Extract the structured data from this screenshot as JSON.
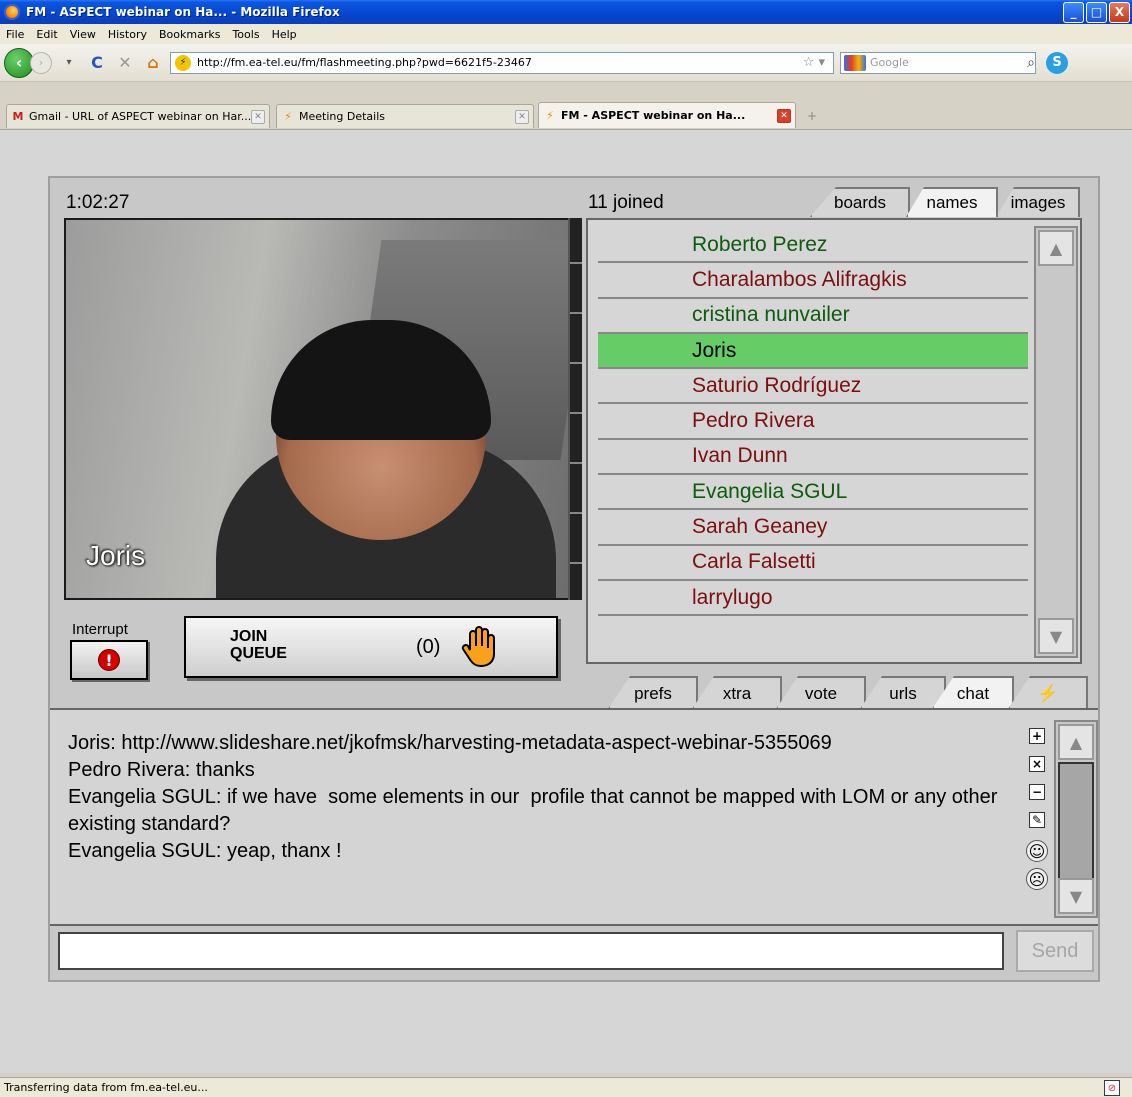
{
  "window": {
    "title": "FM - ASPECT webinar on Ha... - Mozilla Firefox",
    "minimize": "_",
    "maximize": "□",
    "close": "X"
  },
  "menu": [
    "File",
    "Edit",
    "View",
    "History",
    "Bookmarks",
    "Tools",
    "Help"
  ],
  "nav": {
    "url": "http://fm.ea-tel.eu/fm/flashmeeting.php?pwd=6621f5-23467",
    "search_placeholder": "Google"
  },
  "tabs": [
    {
      "label": "Gmail - URL of ASPECT webinar on Har...",
      "icon": "gmail-icon"
    },
    {
      "label": "Meeting Details",
      "icon": "flash-icon"
    },
    {
      "label": "FM - ASPECT webinar on Ha...",
      "icon": "flash-icon",
      "active": true
    }
  ],
  "meeting": {
    "timer": "1:02:27",
    "joined": "11 joined",
    "video_name": "Joris",
    "interrupt_label": "Interrupt",
    "queue_label": "JOIN\nQUEUE",
    "queue_count": "(0)"
  },
  "panel_tabs": [
    "boards",
    "names",
    "images"
  ],
  "active_panel_tab": "names",
  "names": [
    {
      "name": "Roberto Perez",
      "color": "green"
    },
    {
      "name": "Charalambos Alifragkis",
      "color": "red"
    },
    {
      "name": "cristina nunvailer",
      "color": "green"
    },
    {
      "name": "Joris",
      "color": "green",
      "selected": true
    },
    {
      "name": "Saturio Rodríguez",
      "color": "red"
    },
    {
      "name": "Pedro Rivera",
      "color": "red"
    },
    {
      "name": "Ivan Dunn",
      "color": "red"
    },
    {
      "name": "Evangelia SGUL",
      "color": "green"
    },
    {
      "name": "Sarah Geaney",
      "color": "red"
    },
    {
      "name": "Carla Falsetti",
      "color": "red"
    },
    {
      "name": "larrylugo",
      "color": "red"
    }
  ],
  "chat_tabs": [
    "prefs",
    "xtra",
    "vote",
    "urls",
    "chat",
    "⚡"
  ],
  "active_chat_tab": "chat",
  "chat_messages": [
    "Joris: http://www.slideshare.net/jkofmsk/harvesting-metadata-aspect-webinar-5355069",
    "Pedro Rivera: thanks",
    "Evangelia SGUL: if we have  some elements in our  profile that cannot be mapped with LOM or any other existing standard?",
    "Evangelia SGUL: yeap, thanx !"
  ],
  "chat_input_value": "",
  "send_label": "Send",
  "status_text": "Transferring data from fm.ea-tel.eu..."
}
